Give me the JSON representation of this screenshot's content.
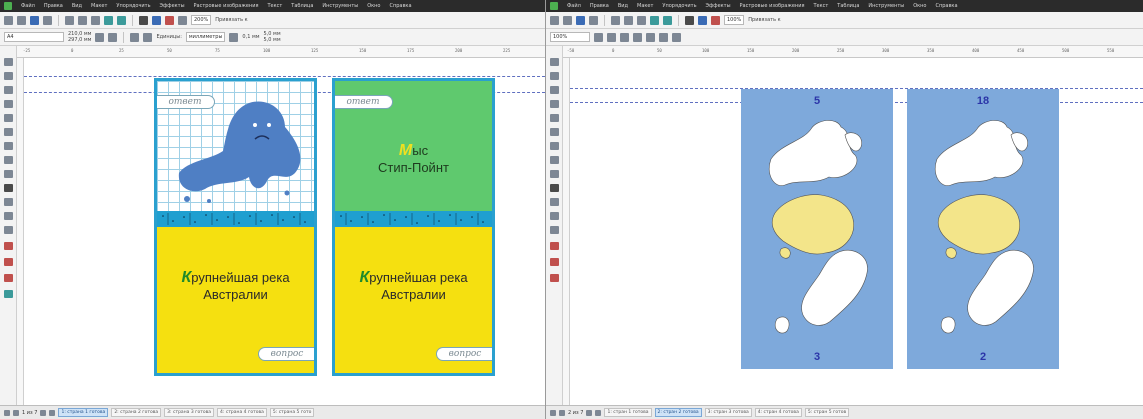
{
  "left_window": {
    "menu": [
      "Файл",
      "Правка",
      "Вид",
      "Макет",
      "Упорядочить",
      "Эффекты",
      "Растровые изображения",
      "Текст",
      "Таблица",
      "Инструменты",
      "Окно",
      "Справка"
    ],
    "zoom": "200%",
    "snap": "Привязать к",
    "paper": "A4",
    "width": "210,0 мм",
    "height": "297,0 мм",
    "units_label": "Единицы:",
    "units": "миллиметры",
    "nudge": "0,1 мм",
    "dup_x": "5,0 мм",
    "dup_y": "5,0 мм",
    "ruler_ticks": [
      "-25",
      "0",
      "25",
      "50",
      "75",
      "100",
      "125",
      "150",
      "175",
      "200",
      "225"
    ],
    "pager": "1 из 7",
    "page_tabs": [
      "1: страна 1 готова",
      "2: страна 2 готова",
      "3: страна 3 готова",
      "4: страна 4 готова",
      "5: страна 5 гото"
    ],
    "cards": [
      {
        "tag_top": "ответ",
        "question_first": "К",
        "question_rest": "рупнейшая река",
        "question_line2": "Австралии",
        "tag_bottom": "вопрос"
      },
      {
        "tag_top": "ответ",
        "answer_first": "М",
        "answer_rest": "ыс",
        "answer_line2": "Стип-Пойнт",
        "question_first": "К",
        "question_rest": "рупнейшая река",
        "question_line2": "Австралии",
        "tag_bottom": "вопрос"
      }
    ]
  },
  "right_window": {
    "menu": [
      "Файл",
      "Правка",
      "Вид",
      "Макет",
      "Упорядочить",
      "Эффекты",
      "Растровые изображения",
      "Текст",
      "Таблица",
      "Инструменты",
      "Окно",
      "Справка"
    ],
    "zoom": "100%",
    "snap": "Привязать к",
    "ruler_ticks": [
      "-50",
      "0",
      "50",
      "100",
      "150",
      "200",
      "250",
      "300",
      "350",
      "400",
      "450",
      "500",
      "550"
    ],
    "pager": "2 из 7",
    "page_tabs": [
      "1: стран 1 готова",
      "2: стран 2 готова",
      "3: стран 3 готова",
      "4: стран 4 готова",
      "5: стран 5 готов"
    ],
    "map_pages": [
      {
        "top_number": "5",
        "bottom_number": "3"
      },
      {
        "top_number": "18",
        "bottom_number": "2"
      }
    ]
  },
  "colors": {
    "card_border": "#2aa0cf",
    "card_green": "#5fc96e",
    "card_yellow": "#f5e010",
    "map_ocean": "#7ea9db",
    "map_highlight": "#f3e58a",
    "blob": "#4f7fc4"
  }
}
